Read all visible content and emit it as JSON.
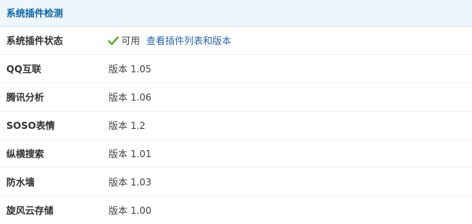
{
  "header": {
    "title": "系统插件检测"
  },
  "status_row": {
    "label": "系统插件状态",
    "icon": "check-icon",
    "status_text": "可用",
    "link_text": "查看插件列表和版本",
    "icon_color": "#5bb33a",
    "link_color": "#2a65a8"
  },
  "plugins": [
    {
      "name": "QQ互联",
      "version": "版本 1.05"
    },
    {
      "name": "腾讯分析",
      "version": "版本 1.06"
    },
    {
      "name": "SOSO表情",
      "version": "版本 1.2"
    },
    {
      "name": "纵横搜索",
      "version": "版本 1.01"
    },
    {
      "name": "防水墙",
      "version": "版本 1.03"
    },
    {
      "name": "旋风云存储",
      "version": "版本 1.00"
    }
  ],
  "colors": {
    "header_bg": "#eef5fb",
    "title": "#0a67a6",
    "label": "#333333",
    "value": "#444444"
  }
}
